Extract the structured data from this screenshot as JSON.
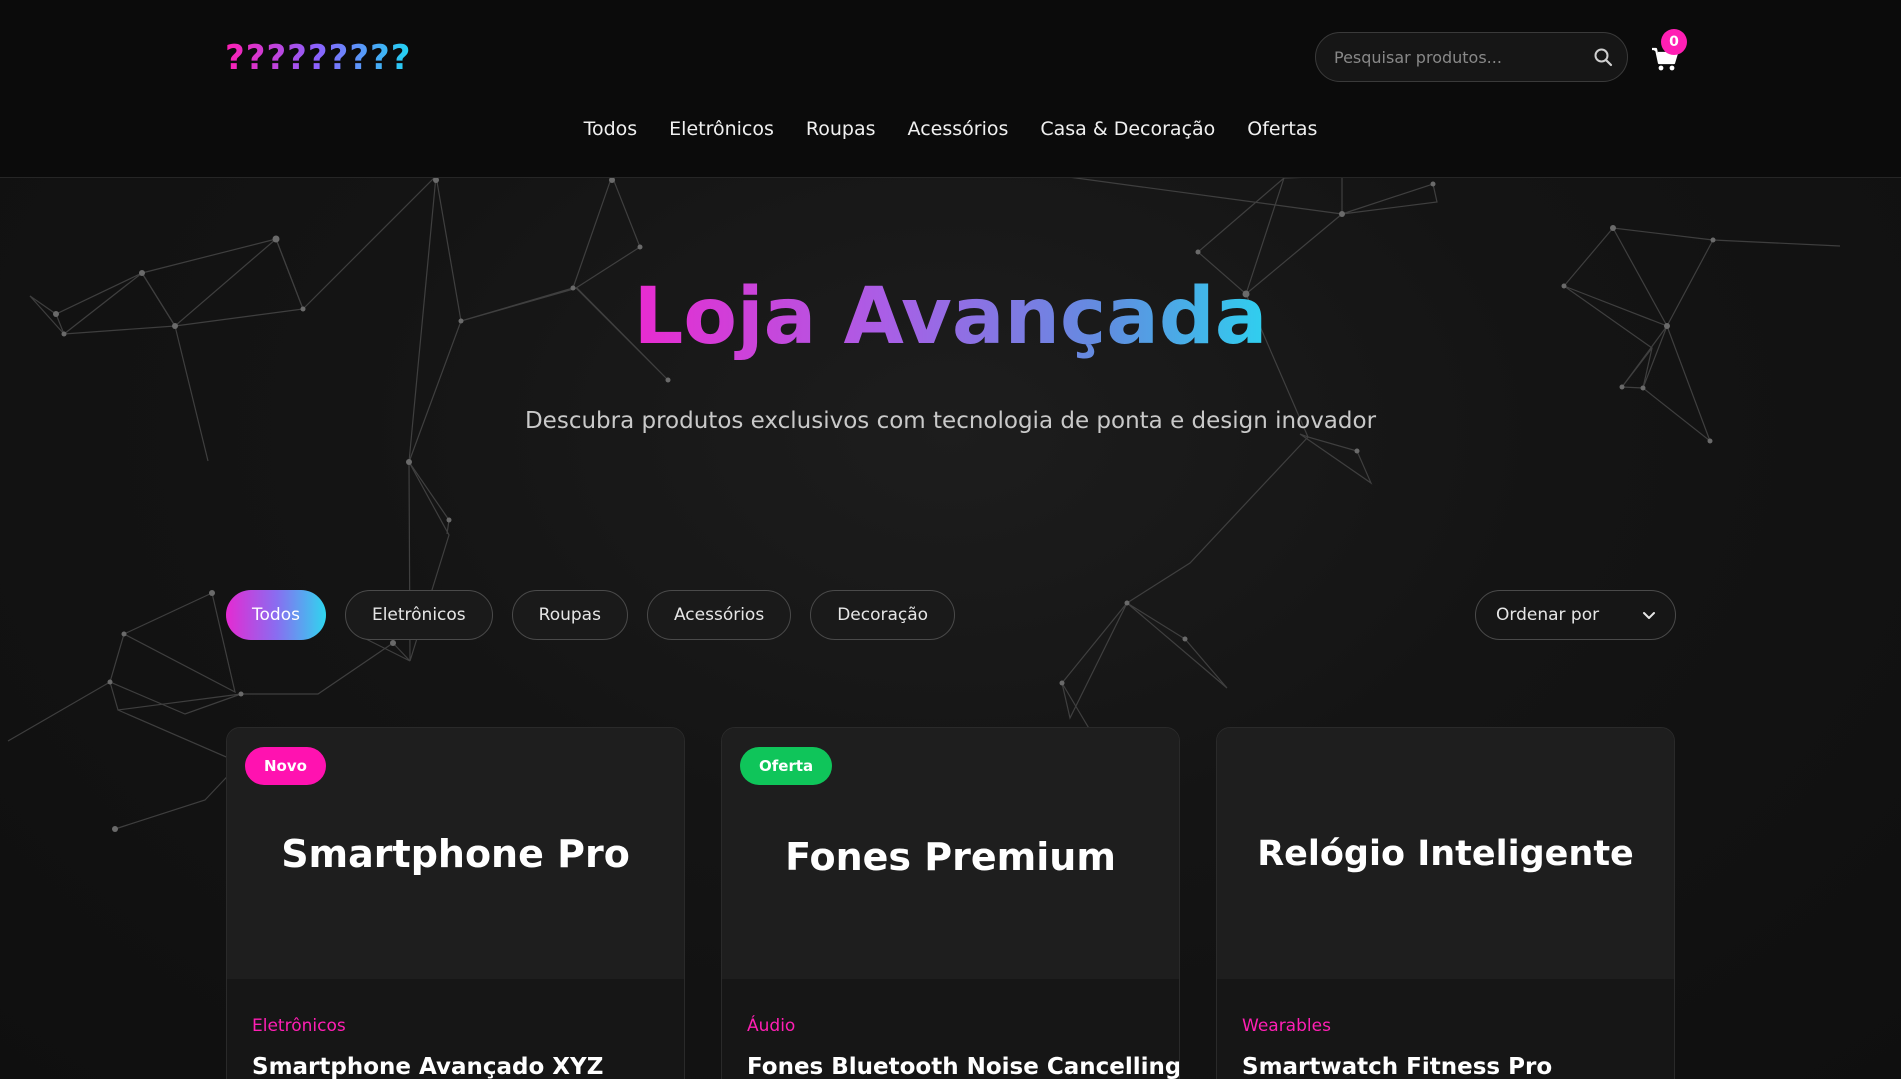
{
  "header": {
    "logo": "?????????",
    "search_placeholder": "Pesquisar produtos...",
    "cart_count": "0",
    "nav": [
      "Todos",
      "Eletrônicos",
      "Roupas",
      "Acessórios",
      "Casa & Decoração",
      "Ofertas"
    ]
  },
  "hero": {
    "title": "Loja Avançada",
    "subtitle": "Descubra produtos exclusivos com tecnologia de ponta e design inovador"
  },
  "filters": {
    "chips": [
      "Todos",
      "Eletrônicos",
      "Roupas",
      "Acessórios",
      "Decoração"
    ],
    "active": "Todos",
    "sort_label": "Ordenar por"
  },
  "products": [
    {
      "badge": "Novo",
      "badge_color": "#ff12b0",
      "image_title": "Smartphone Pro",
      "category": "Eletrônicos",
      "name": "Smartphone Avançado XYZ"
    },
    {
      "badge": "Oferta",
      "badge_color": "#0fc55a",
      "image_title": "Fones Premium",
      "category": "Áudio",
      "name": "Fones Bluetooth Noise Cancelling"
    },
    {
      "badge": "",
      "badge_color": "",
      "image_title": "Relógio Inteligente",
      "category": "Wearables",
      "name": "Smartwatch Fitness Pro"
    }
  ],
  "colors": {
    "accent_pink": "#ff1fb4",
    "accent_cyan": "#2fd6ef",
    "background": "#0e0e0e"
  }
}
